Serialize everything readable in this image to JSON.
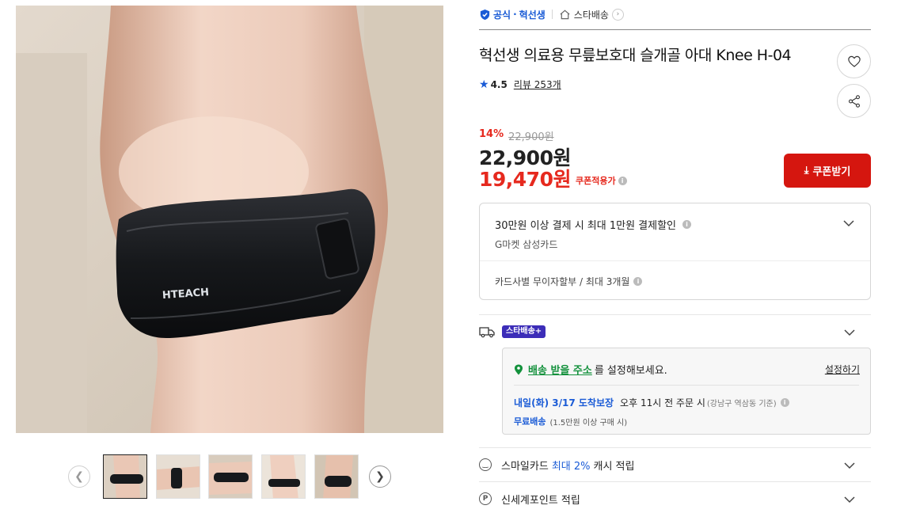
{
  "seller": {
    "official_label": "공식",
    "brand_name": "혁선생",
    "delivery_label": "스타배송"
  },
  "product": {
    "title": "혁선생 의료용 무릎보호대 슬개골 아대 Knee H-04",
    "rating": "4.5",
    "review_link": "리뷰 253개",
    "image_brand_text": "HTEACH",
    "thumbnails_count": 5
  },
  "price": {
    "discount_rate": "14%",
    "original_price": "22,900원",
    "price": "22,900원",
    "coupon_price": "19,470원",
    "coupon_label": "쿠폰적용가",
    "coupon_button": "쿠폰받기"
  },
  "card_benefit": {
    "title": "30만원 이상 결제 시 최대 1만원 결제할인",
    "subtitle": "G마켓 삼성카드",
    "installment": "카드사별 무이자할부 / 최대 3개월"
  },
  "shipping": {
    "badge": "스타배송+",
    "address_link": "배송 받을 주소",
    "address_rest": "를 설정해보세요.",
    "set_link": "설정하기",
    "arrive_date": "내일(화) 3/17 도착보장",
    "arrive_cutoff": "오후 11시 전 주문 시",
    "arrive_location": "(강남구 역삼동 기준)",
    "free_shipping": "무료배송",
    "free_condition": "(1.5만원 이상 구매 시)"
  },
  "benefits": [
    {
      "prefix": "스마일카드",
      "highlight": "최대 2%",
      "suffix": "캐시 적립"
    },
    {
      "prefix": "신세계포인트 적립",
      "highlight": "",
      "suffix": ""
    }
  ],
  "colors": {
    "accent_blue": "#1a5bd6",
    "sale_red": "#e6291e",
    "coupon_button": "#d5160f",
    "address_green": "#13913c",
    "star_badge": "#3c2db8"
  }
}
